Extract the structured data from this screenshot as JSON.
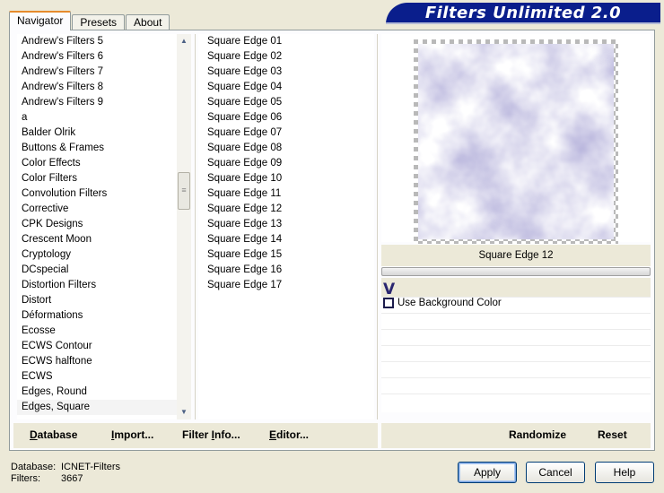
{
  "tabs": [
    {
      "label": "Navigator",
      "active": true
    },
    {
      "label": "Presets",
      "active": false
    },
    {
      "label": "About",
      "active": false
    }
  ],
  "banner": {
    "title": "Filters Unlimited 2.0"
  },
  "categories": [
    "Andrew's Filters 5",
    "Andrew's Filters 6",
    "Andrew's Filters 7",
    "Andrew's Filters 8",
    "Andrew's Filters 9",
    "a",
    "Balder Olrik",
    "Buttons & Frames",
    "Color Effects",
    "Color Filters",
    "Convolution Filters",
    "Corrective",
    "CPK Designs",
    "Crescent Moon",
    "Cryptology",
    "DCspecial",
    "Distortion Filters",
    "Distort",
    "Déformations",
    "Ecosse",
    "ECWS Contour",
    "ECWS halftone",
    "ECWS",
    "Edges, Round",
    "Edges, Square"
  ],
  "selected_category": "Edges, Square",
  "filters": [
    "Square Edge 01",
    "Square Edge 02",
    "Square Edge 03",
    "Square Edge 04",
    "Square Edge 05",
    "Square Edge 06",
    "Square Edge 07",
    "Square Edge 08",
    "Square Edge 09",
    "Square Edge 10",
    "Square Edge 11",
    "Square Edge 12",
    "Square Edge 13",
    "Square Edge 14",
    "Square Edge 15",
    "Square Edge 16",
    "Square Edge 17"
  ],
  "selected_filter": "Square Edge 12",
  "controls": {
    "v_mark": "V",
    "use_bg_label": "Use Background Color"
  },
  "toolbar": {
    "database": {
      "u": "D",
      "rest": "atabase"
    },
    "import": {
      "u": "I",
      "rest": "mport..."
    },
    "filter_info": {
      "pre": "Filter ",
      "u": "I",
      "rest": "nfo..."
    },
    "editor": {
      "u": "E",
      "rest": "ditor..."
    },
    "randomize": "Randomize",
    "reset": "Reset"
  },
  "footer": {
    "database_label": "Database:",
    "database_value": "ICNET-Filters",
    "filters_label": "Filters:",
    "filters_value": "3667"
  },
  "buttons": {
    "apply": "Apply",
    "cancel": "Cancel",
    "help": "Help"
  },
  "colors": {
    "banner_bg": "#0a1e8c",
    "accent_tab": "#e68b2c",
    "preview_tint": "#6a64aa"
  }
}
